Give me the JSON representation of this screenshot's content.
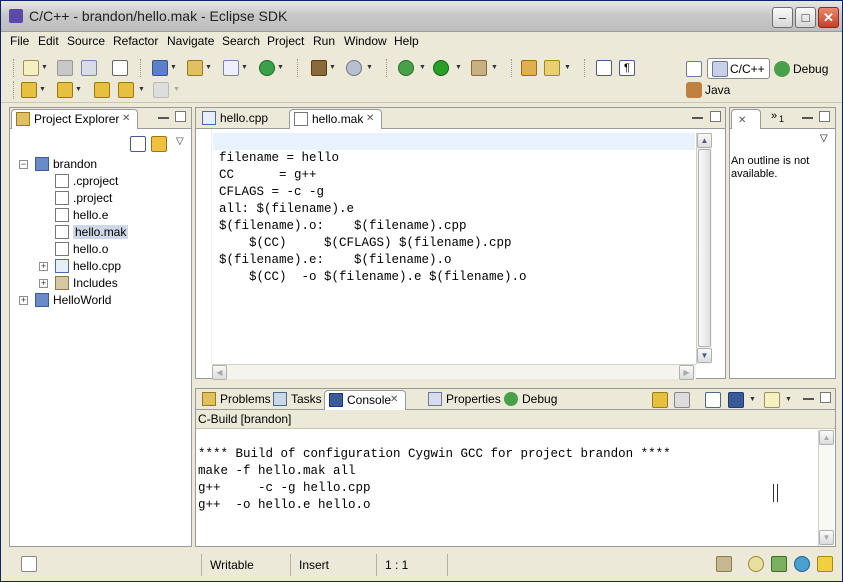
{
  "window": {
    "title": "C/C++ - brandon/hello.mak - Eclipse SDK"
  },
  "menu": [
    "File",
    "Edit",
    "Source",
    "Refactor",
    "Navigate",
    "Search",
    "Project",
    "Run",
    "Window",
    "Help"
  ],
  "perspectives": {
    "cpp": "C/C++",
    "debug": "Debug",
    "java": "Java"
  },
  "explorer": {
    "tab": "Project Explorer",
    "items": [
      {
        "label": "brandon"
      },
      {
        "label": ".cproject"
      },
      {
        "label": ".project"
      },
      {
        "label": "hello.e"
      },
      {
        "label": "hello.mak"
      },
      {
        "label": "hello.o"
      },
      {
        "label": "hello.cpp"
      },
      {
        "label": "Includes"
      },
      {
        "label": "HelloWorld"
      }
    ]
  },
  "editor": {
    "tabs": [
      {
        "label": "hello.cpp"
      },
      {
        "label": "hello.mak"
      }
    ],
    "lines": [
      "filename = hello",
      "",
      "CC      = g++",
      "CFLAGS = -c -g",
      "",
      "all: $(filename).e",
      "",
      "$(filename).o:    $(filename).cpp",
      "    $(CC)     $(CFLAGS) $(filename).cpp",
      "",
      "",
      "$(filename).e:    $(filename).o",
      "    $(CC)  -o $(filename).e $(filename).o"
    ]
  },
  "outline": {
    "tab_label": "1",
    "message": "An outline is not available."
  },
  "bottom": {
    "tabs": [
      {
        "label": "Problems"
      },
      {
        "label": "Tasks"
      },
      {
        "label": "Console"
      },
      {
        "label": "Properties"
      },
      {
        "label": "Debug"
      }
    ],
    "console_title": "C-Build [brandon]",
    "console_lines": [
      "",
      "**** Build of configuration Cygwin GCC for project brandon ****",
      "",
      "make -f hello.mak all",
      "g++     -c -g hello.cpp",
      "g++  -o hello.e hello.o"
    ]
  },
  "status": {
    "writable": "Writable",
    "insert": "Insert",
    "position": "1 : 1"
  },
  "colors": {
    "selection": "#cfd8e6",
    "current_line": "#e8f2fe",
    "title_text": "#222222"
  }
}
